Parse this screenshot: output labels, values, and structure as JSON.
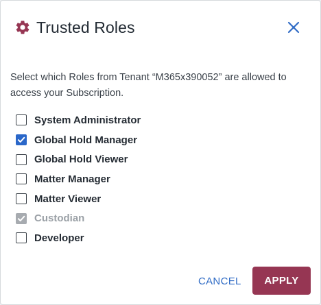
{
  "dialog": {
    "title": "Trusted Roles",
    "description": "Select which Roles from Tenant “M365x390052” are allowed to access your Subscription."
  },
  "roles": [
    {
      "label": "System Administrator",
      "checked": false,
      "disabled": false
    },
    {
      "label": "Global Hold Manager",
      "checked": true,
      "disabled": false
    },
    {
      "label": "Global Hold Viewer",
      "checked": false,
      "disabled": false
    },
    {
      "label": "Matter Manager",
      "checked": false,
      "disabled": false
    },
    {
      "label": "Matter Viewer",
      "checked": false,
      "disabled": false
    },
    {
      "label": "Custodian",
      "checked": true,
      "disabled": true
    },
    {
      "label": "Developer",
      "checked": false,
      "disabled": false
    }
  ],
  "buttons": {
    "cancel": "CANCEL",
    "apply": "APPLY"
  },
  "colors": {
    "accent": "#963653",
    "link": "#2f6bc5",
    "checkbox_checked": "#2a67c9",
    "checkbox_disabled": "#a7abb0"
  },
  "icons": {
    "title_icon": "gear-icon",
    "close_icon": "close-icon",
    "check_icon": "check-icon"
  }
}
